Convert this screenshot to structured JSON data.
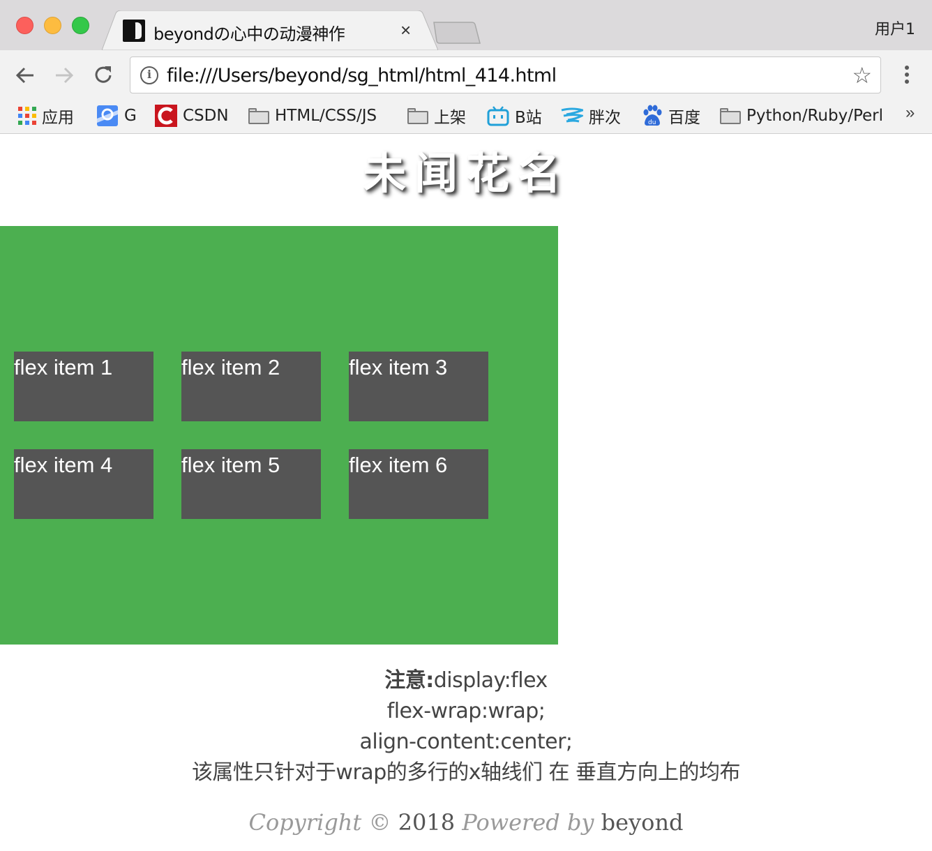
{
  "browser": {
    "tab_title": "beyondの心中の动漫神作",
    "tab_close": "×",
    "profile_name": "用户1",
    "url": "file:///Users/beyond/sg_html/html_414.html",
    "star_icon": "☆"
  },
  "bookmarks": {
    "items": [
      {
        "label": "应用",
        "icon": "apps-grid-icon"
      },
      {
        "label": "G",
        "icon": "google-maps-icon"
      },
      {
        "label": "CSDN",
        "icon": "csdn-icon"
      },
      {
        "label": "HTML/CSS/JS",
        "icon": "folder-icon"
      },
      {
        "label": "上架",
        "icon": "folder-icon"
      },
      {
        "label": "B站",
        "icon": "bilibili-icon"
      },
      {
        "label": "胖次",
        "icon": "wave-icon"
      },
      {
        "label": "百度",
        "icon": "baidu-paw-icon"
      },
      {
        "label": "Python/Ruby/Perl",
        "icon": "folder-icon"
      }
    ],
    "more": "»"
  },
  "page": {
    "title": "未闻花名",
    "flex_items": [
      "flex item 1",
      "flex item 2",
      "flex item 3",
      "flex item 4",
      "flex item 5",
      "flex item 6"
    ],
    "note": {
      "label": "注意:",
      "line1": "display:flex",
      "line2": "flex-wrap:wrap;",
      "line3": "align-content:center;",
      "line4": "该属性只针对于wrap的多行的x轴线们 在 垂直方向上的均布"
    },
    "footer": {
      "copyright": "Copyright",
      "symbol": "©",
      "year": "2018",
      "powered_by": "Powered by",
      "author": "beyond"
    }
  },
  "colors": {
    "container_bg": "#4caf50",
    "item_bg": "#555555"
  }
}
